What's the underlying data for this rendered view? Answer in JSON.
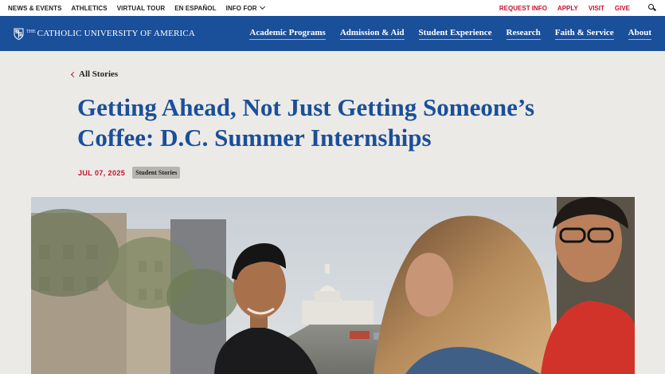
{
  "utility_nav": {
    "left_links": [
      "NEWS & EVENTS",
      "ATHLETICS",
      "VIRTUAL TOUR",
      "EN ESPAÑOL"
    ],
    "info_for": "INFO FOR",
    "right_links": [
      "REQUEST INFO",
      "APPLY",
      "VISIT",
      "GIVE"
    ],
    "search_icon": "search-icon"
  },
  "brand": {
    "the": "THE",
    "name": "CATHOLIC UNIVERSITY OF AMERICA",
    "logo_icon": "shield-logo-icon"
  },
  "main_nav": {
    "items": [
      "Academic Programs",
      "Admission & Aid",
      "Student Experience",
      "Research",
      "Faith & Service",
      "About"
    ]
  },
  "article": {
    "back_label": "All Stories",
    "title": "Getting Ahead, Not Just Getting Someone’s Coffee: D.C. Summer Internships",
    "date": "JUL 07, 2025",
    "tag": "Student Stories"
  },
  "colors": {
    "brand_blue": "#1a4f9a",
    "accent_red": "#c8102e",
    "page_bg": "#eceae6"
  }
}
